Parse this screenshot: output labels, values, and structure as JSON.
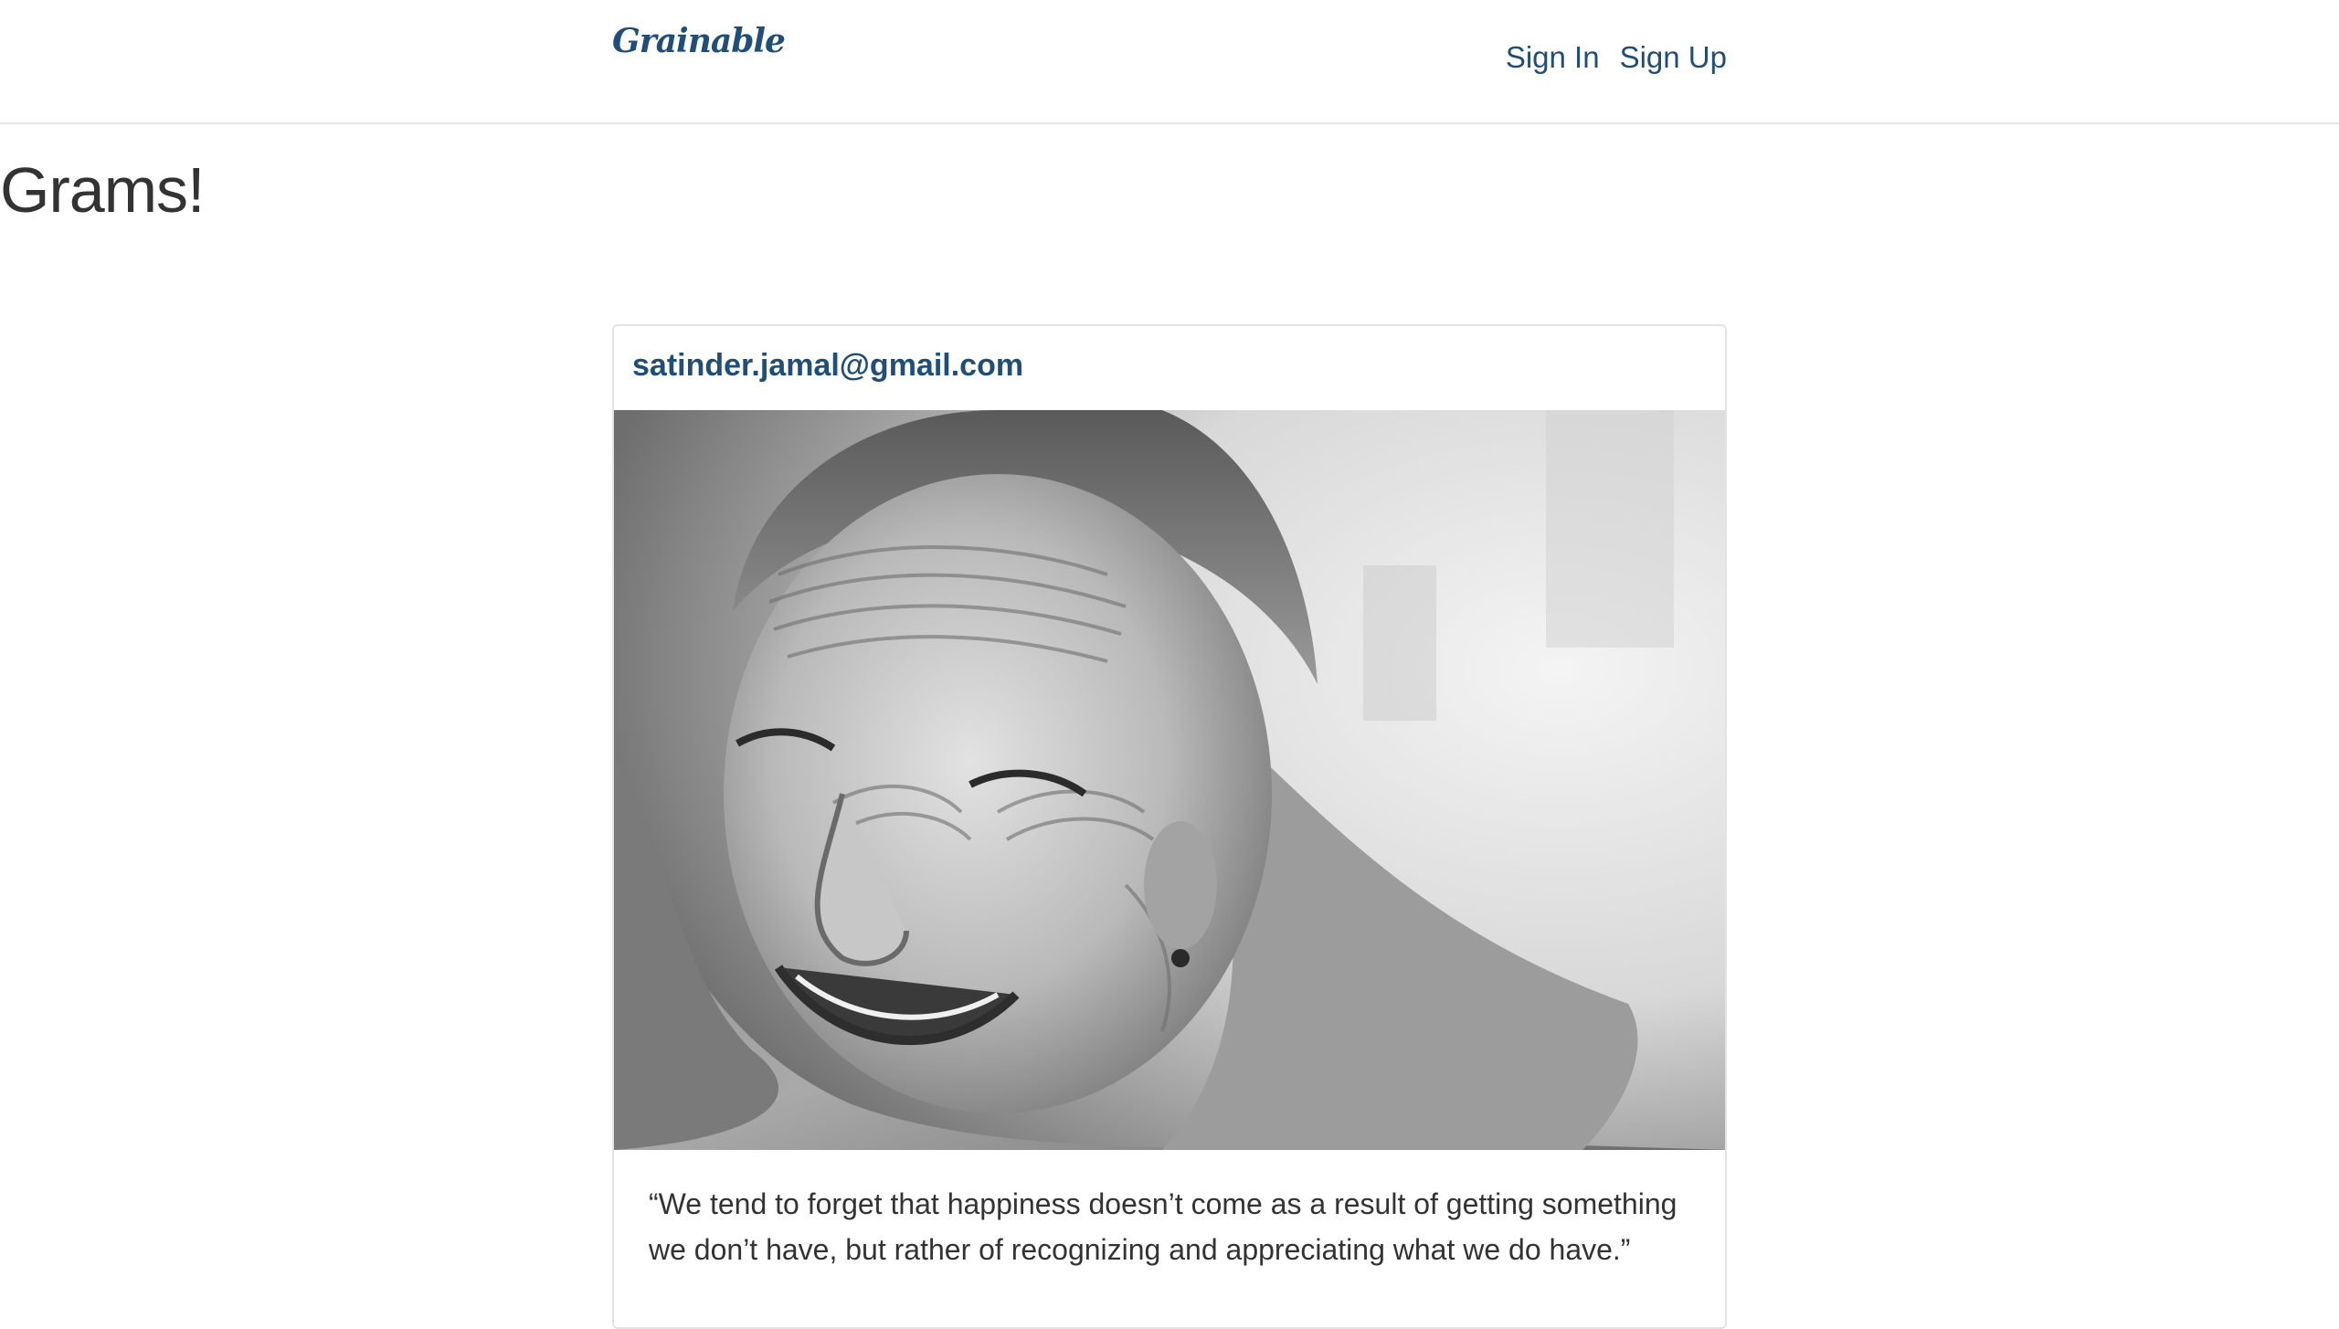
{
  "navbar": {
    "brand": "Grainable",
    "links": [
      {
        "label": "Sign In"
      },
      {
        "label": "Sign Up"
      }
    ]
  },
  "page": {
    "heading": "Grams!"
  },
  "gram": {
    "author_email": "satinder.jamal@gmail.com",
    "photo_alt": "Black and white portrait of a smiling elderly woman wrapped in a shawl",
    "caption": "“We tend to forget that happiness doesn’t come as a result of getting something we don’t have, but rather of recognizing and appreciating what we do have.”"
  },
  "colors": {
    "brand": "#1f4e79",
    "text": "#333333",
    "border": "#e3e3e3"
  }
}
